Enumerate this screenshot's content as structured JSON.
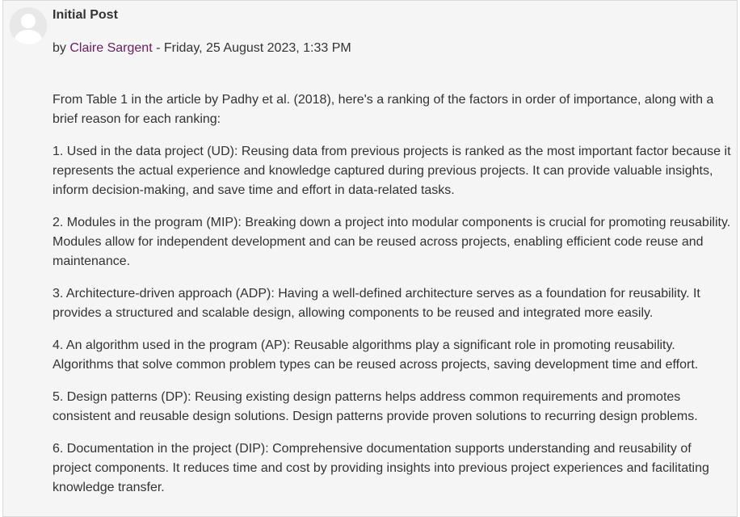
{
  "post": {
    "subject": "Initial Post",
    "byline": {
      "prefix": "by",
      "author": "Claire Sargent",
      "separator": "-",
      "datetime": "Friday, 25 August 2023, 1:33 PM"
    },
    "paragraphs": [
      "From Table 1 in the article by Padhy et al. (2018), here's a ranking of the factors in order of importance, along with a brief reason for each ranking:",
      "1. Used in the data project (UD): Reusing data from previous projects is ranked as the most important factor because it represents the actual experience and knowledge captured during previous projects. It can provide valuable insights, inform decision-making, and save time and effort in data-related tasks.",
      "2. Modules in the program (MIP): Breaking down a project into modular components is crucial for promoting reusability. Modules allow for independent development and can be reused across projects, enabling efficient code reuse and maintenance.",
      "3. Architecture-driven approach (ADP): Having a well-defined architecture serves as a foundation for reusability. It provides a structured and scalable design, allowing components to be reused and integrated more easily.",
      "4. An algorithm used in the program (AP): Reusable algorithms play a significant role in promoting reusability. Algorithms that solve common problem types can be reused across projects, saving development time and effort.",
      "5. Design patterns (DP): Reusing existing design patterns helps address common requirements and promotes consistent and reusable design solutions. Design patterns provide proven solutions to recurring design problems.",
      "6. Documentation in the project (DIP): Comprehensive documentation supports understanding and reusability of project components. It reduces time and cost by providing insights into previous project experiences and facilitating knowledge transfer."
    ]
  },
  "colors": {
    "author_link": "#6a1b62",
    "text": "#333333",
    "post_background": "#f5f5f5"
  },
  "icons": {
    "avatar": "default-user-avatar-icon"
  }
}
